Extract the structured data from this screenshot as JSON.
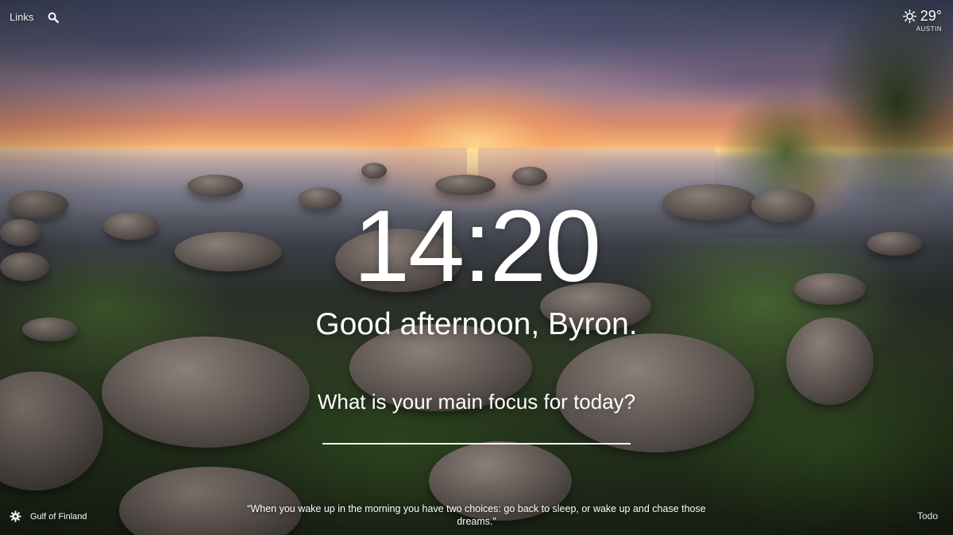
{
  "top_left": {
    "links_label": "Links",
    "search_icon": "search-icon"
  },
  "weather": {
    "icon": "sun-icon",
    "temperature": "29°",
    "city": "AUSTIN"
  },
  "clock": {
    "time": "14:20"
  },
  "greeting": {
    "text": "Good afternoon, Byron."
  },
  "focus": {
    "question": "What is your main focus for today?",
    "value": ""
  },
  "footer": {
    "settings_icon": "gear-icon",
    "location": "Gulf of Finland",
    "quote": "“When you wake up in the morning you have two choices: go back to sleep, or wake up and chase those dreams.”",
    "todo_label": "Todo"
  },
  "colors": {
    "text": "#ffffff"
  }
}
